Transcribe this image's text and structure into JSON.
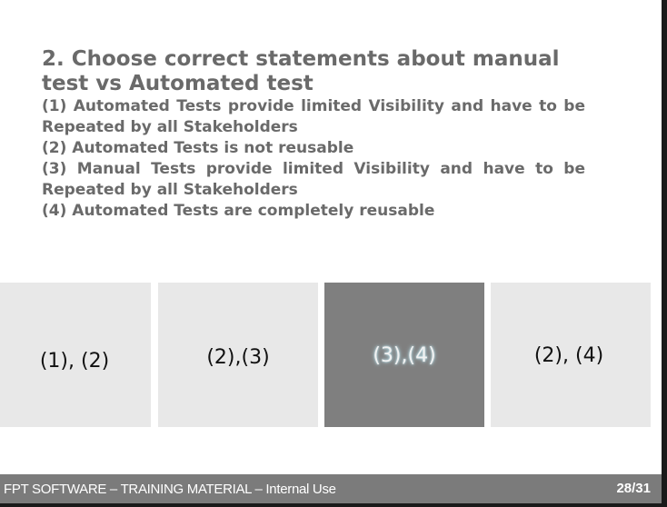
{
  "question": {
    "title": "2. Choose correct statements about manual test vs Automated test",
    "statements": [
      "(1) Automated Tests provide limited Visibility and have to be Repeated by all Stakeholders",
      "(2) Automated Tests is not reusable",
      "(3) Manual Tests provide limited Visibility and have to be Repeated by all Stakeholders",
      "(4) Automated Tests are completely reusable"
    ]
  },
  "options": [
    {
      "label": "(1), (2)"
    },
    {
      "label": "(2),(3)"
    },
    {
      "label": "(3),(4)"
    },
    {
      "label": "(2), (4)"
    }
  ],
  "selected_option": "(3),(4)",
  "footer": {
    "text": "FPT SOFTWARE – TRAINING MATERIAL – Internal Use",
    "page": "28/31"
  },
  "colors": {
    "text_gray": "#6a6a6a",
    "option_bg": "#e8e8e8",
    "option_selected_bg": "#7f7f7f",
    "footer_bg": "#7b7b7b"
  }
}
